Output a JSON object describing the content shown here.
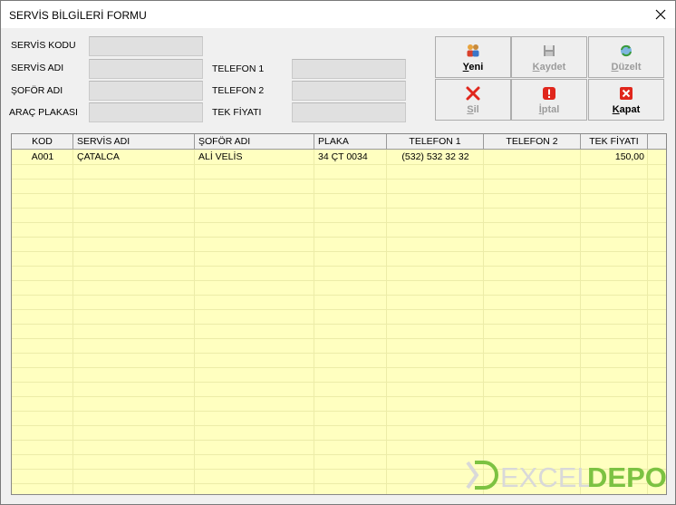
{
  "window": {
    "title": "SERVİS BİLGİLERİ FORMU"
  },
  "labels": {
    "servis_kodu": "SERVİS KODU",
    "servis_adi": "SERVİS ADI",
    "sofor_adi": "ŞOFÖR ADI",
    "arac_plakasi": "ARAÇ PLAKASI",
    "telefon1": "TELEFON 1",
    "telefon2": "TELEFON 2",
    "tek_fiyati": "TEK FİYATI"
  },
  "buttons": {
    "yeni": {
      "hot": "Y",
      "rest": "eni",
      "enabled": true
    },
    "kaydet": {
      "hot": "K",
      "rest": "aydet",
      "enabled": false
    },
    "duzelt": {
      "hot": "D",
      "rest": "üzelt",
      "enabled": false
    },
    "sil": {
      "hot": "S",
      "rest": "il",
      "enabled": false
    },
    "iptal": {
      "hot": "İ",
      "rest": "ptal",
      "enabled": false
    },
    "kapat": {
      "hot": "K",
      "rest": "apat",
      "enabled": true
    }
  },
  "grid": {
    "columns": [
      "KOD",
      "SERVİS ADI",
      "ŞOFÖR ADI",
      "PLAKA",
      "TELEFON 1",
      "TELEFON 2",
      "TEK FİYATI"
    ],
    "rows": [
      {
        "kod": "A001",
        "servis_adi": "ÇATALCA",
        "sofor_adi": "ALİ VELİS",
        "plaka": "34 ÇT 0034",
        "telefon1": "(532) 532 32 32",
        "telefon2": "",
        "tek_fiyati": "150,00"
      }
    ]
  },
  "logo": {
    "left": "EXCEL",
    "right": "DEPO"
  },
  "colors": {
    "grid_bg": "#ffffc0",
    "logo_green": "#7cc242",
    "logo_gray": "#d9d9d9"
  }
}
